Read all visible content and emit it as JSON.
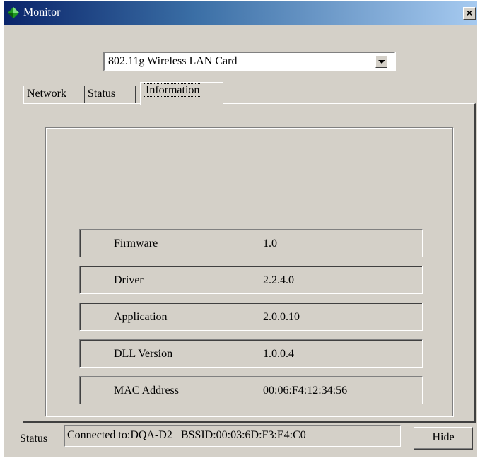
{
  "window": {
    "title": "Monitor",
    "close_glyph": "×",
    "title_icon": "green-diamond-icon"
  },
  "adapter": {
    "selected": "802.11g Wireless LAN Card"
  },
  "tabs": [
    {
      "label": "Network"
    },
    {
      "label": "Status"
    },
    {
      "label": "Information",
      "active": true
    }
  ],
  "information": [
    {
      "label": "Firmware",
      "value": "1.0"
    },
    {
      "label": "Driver",
      "value": "2.2.4.0"
    },
    {
      "label": "Application",
      "value": "2.0.0.10"
    },
    {
      "label": "DLL Version",
      "value": "1.0.0.4"
    },
    {
      "label": "MAC Address",
      "value": "00:06:F4:12:34:56"
    }
  ],
  "statusbar": {
    "label": "Status",
    "text": "Connected to:DQA-D2   BSSID:00:03:6D:F3:E4:C0",
    "hide_label": "Hide"
  },
  "colors": {
    "face": "#d4d0c8",
    "title_start": "#0a246a",
    "title_end": "#a6caf0"
  }
}
